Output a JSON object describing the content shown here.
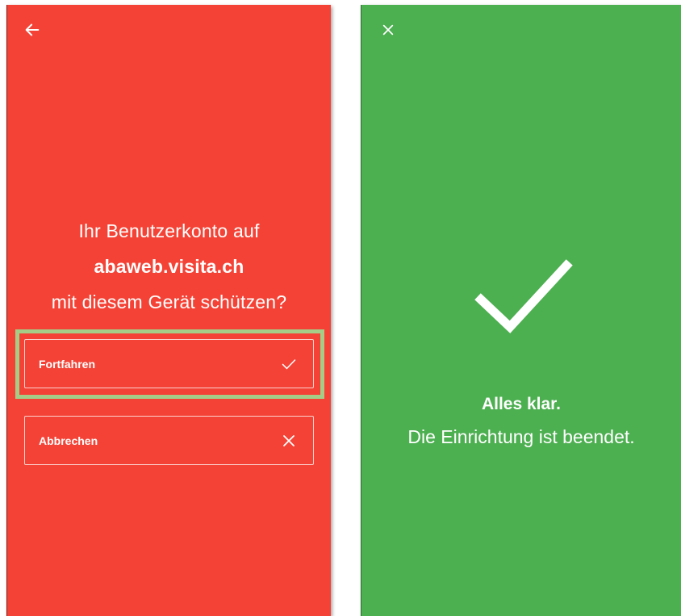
{
  "left_screen": {
    "background_color": "#f44336",
    "back_icon": "arrow-left-icon",
    "prompt": {
      "line1": "Ihr Benutzerkonto auf",
      "domain": "abaweb.visita.ch",
      "line3": "mit diesem Gerät schützen?"
    },
    "continue_button": {
      "label": "Fortfahren",
      "icon": "check-icon",
      "highlighted": true,
      "highlight_color": "#a5cd87"
    },
    "cancel_button": {
      "label": "Abbrechen",
      "icon": "close-icon"
    }
  },
  "right_screen": {
    "background_color": "#4caf50",
    "close_icon": "close-icon",
    "success_icon": "large-check-icon",
    "title": "Alles klar.",
    "message": "Die Einrichtung ist beendet."
  }
}
